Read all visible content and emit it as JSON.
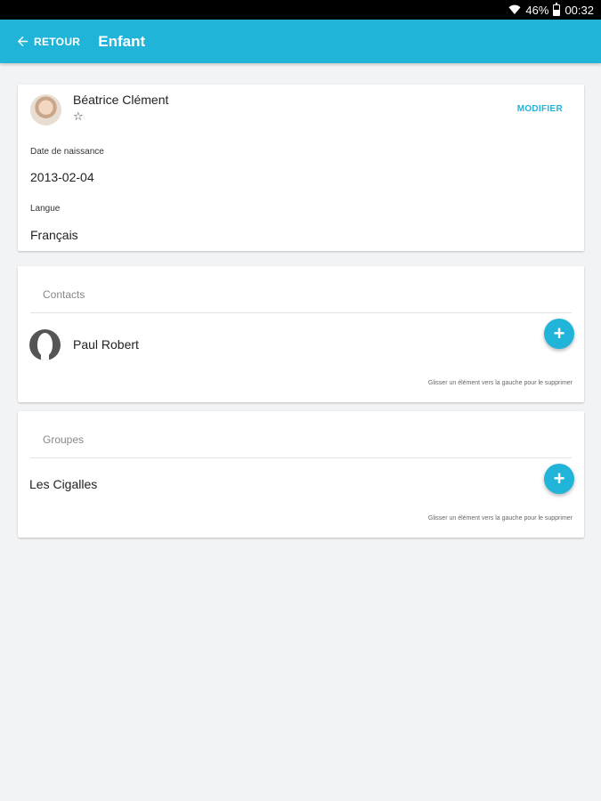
{
  "status_bar": {
    "battery": "46%",
    "time": "00:32",
    "battery_level": 0.46
  },
  "app_bar": {
    "back_label": "RETOUR",
    "title": "Enfant"
  },
  "profile": {
    "name": "Béatrice Clément",
    "star": "☆",
    "modify_label": "MODIFIER",
    "birth_label": "Date de naissance",
    "birth_value": "2013-02-04",
    "language_label": "Langue",
    "language_value": "Français"
  },
  "contacts": {
    "title": "Contacts",
    "items": [
      {
        "name": "Paul Robert"
      }
    ],
    "add_label": "+",
    "hint": "Glisser un élément vers la gauche pour le supprimer"
  },
  "groups": {
    "title": "Groupes",
    "items": [
      {
        "name": "Les Cigalles"
      }
    ],
    "add_label": "+",
    "hint": "Glisser un élément vers la gauche pour le supprimer"
  },
  "colors": {
    "accent": "#20b4d9",
    "background": "#f2f3f5"
  }
}
